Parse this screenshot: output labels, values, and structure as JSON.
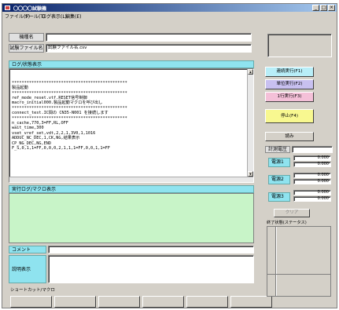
{
  "window": {
    "title": "〇〇〇〇試験機",
    "controls": [
      "_",
      "□",
      "×"
    ],
    "menu": [
      "ファイル(F)",
      "ツール(T)",
      "ログ表示(L)",
      "編集(E)"
    ]
  },
  "top": {
    "label1": "機種名",
    "field1": "",
    "label2": "試験ファイル名",
    "field2": "試験ファイル名.csv"
  },
  "log": {
    "header": "ログ/状態表示",
    "lines": [
      "***********************************************",
      "製品起動",
      "***********************************************",
      "ref_mode_reset.vtf.RESET信号制御",
      "",
      "macro_initial000.製品起動マクロを呼び出し",
      "",
      "***********************************************",
      "connect_test.IC間の CN35-N001 を接続します",
      "***********************************************",
      "n_cache,770,3=FF,RL,OFF",
      "wait_time,300",
      "vset_vref_set,vdt,2,2,1,3V0,1,1016",
      "ADDUC_NC_DEC,1,CK,NG,結果表示",
      "CP_NG_DEC,NG,END",
      "F_S,0,1,1=FF,0,0,0,2,1,1,1=FF,0,0,1,1=FF"
    ]
  },
  "macro": {
    "header": "実行ログ/マクロ表示"
  },
  "comment": {
    "label": "コメント",
    "value": ""
  },
  "explain": {
    "label": "説明表示",
    "value": ""
  },
  "footer": {
    "label": "ショートカット/マクロ",
    "slots": [
      "",
      "",
      "",
      "",
      "",
      ""
    ]
  },
  "right": {
    "buttons": [
      {
        "label": "連続実行(F1)",
        "color": "#b8eef8"
      },
      {
        "label": "単位実行(F2)",
        "color": "#c8c0f0"
      },
      {
        "label": "1行実行(F3)",
        "color": "#f4c0d8"
      },
      {
        "label": "停止(F4)",
        "color": "#f8f890"
      },
      {
        "label": "読み",
        "color": "#d4d0c8"
      }
    ],
    "measure_label": "計測電圧",
    "groups": [
      {
        "label": "電源1",
        "values": [
          "0.000",
          "0.000"
        ]
      },
      {
        "label": "電源2",
        "values": [
          "0.000",
          "0.000"
        ]
      },
      {
        "label": "電源3",
        "values": [
          "0.000",
          "0.000"
        ]
      }
    ],
    "clear_label": "クリア",
    "history_label": "終了状態(ステータス)"
  }
}
